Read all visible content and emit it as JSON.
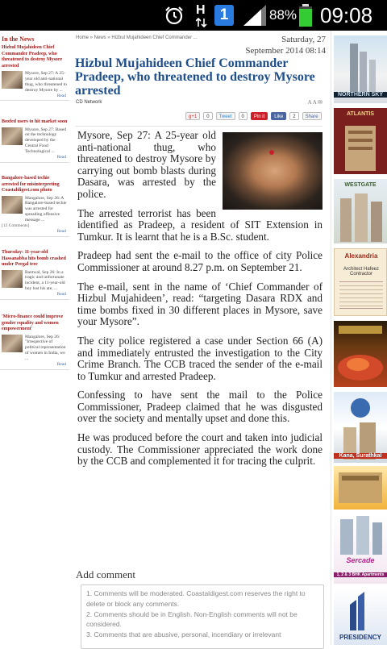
{
  "status_bar": {
    "battery_percent": "88%",
    "time": "09:08",
    "network": "H",
    "notification_badge": "1"
  },
  "sidebar": {
    "title": "In the News",
    "items": [
      {
        "title": "Hizbul Mujahideen Chief Commander Pradeep, who threatened to destroy Mysore arrested",
        "excerpt": "Mysore, Sep 27: A 25-year old anti-national thug, who threatened to destroy Mysore by ...",
        "read": "Read"
      },
      {
        "title": "Boxfed users to hit market soon",
        "excerpt": "Mysore, Sep 27: Based on the technology developed by the Central Food Technological ...",
        "read": "Read"
      },
      {
        "title": "Bangalore-based techie arrested for misinterpreting Coastaldigest.com photo",
        "excerpt": "Mangalore, Sep 26: A Bangalore-based techie was arrested for spreading offensive message ...",
        "comments": "[12 Comments]",
        "read": "Read"
      },
      {
        "title": "Thursday: 11-year-old Hassanabba hits bomb crashed under Pergal tree",
        "excerpt": "Bantwal, Sep 26: In a tragic and unfortunate incident, a 11-year-old boy lost his ate, ...",
        "read": "Read"
      },
      {
        "title": "'Micro-finance could improve gender equality and women empowerment'",
        "excerpt": "Mangalore, Sep 26: \"Irrespective of political representation of women in India, we ...",
        "read": "Read"
      }
    ]
  },
  "article": {
    "breadcrumb": "Home » News » Hizbul Mujahideen Chief Commander ...",
    "date_line1": "Saturday, 27",
    "date_line2": "September 2014 08:14",
    "headline": "Hizbul Mujahideen Chief Commander Pradeep, who threatened to destroy Mysore arrested",
    "author": "CD Network",
    "tools_icons": "A A ✉",
    "share": {
      "gplus": "g+1",
      "gplus_count": "0",
      "tweet": "Tweet",
      "tweet_count": "0",
      "pin": "Pin it",
      "like": "Like",
      "like_count": "2",
      "fb_share": "Share"
    },
    "paragraphs": [
      "Mysore, Sep 27: A 25-year old anti-national thug, who threatened to destroy Mysore by carrying out bomb blasts during Dasara, was arrested by the police.",
      "The arrested terrorist has been identified as Pradeep, a resident of SIT Extension in Tumkur. It is learnt that he is a B.Sc. student.",
      "Pradeep had sent the e-mail to the office of city Police Commissioner at around 8.27 p.m. on September 21.",
      "The e-mail, sent in the name of ‘Chief Commander of Hizbul Mujahideen’, read: “targeting Dasara RDX and time bombs fixed in 30 different places in Mysore, save your Mysore”.",
      "The city police registered a case under Section 66 (A) and immediately entrusted the investigation to the City Crime Branch. The CCB traced the sender of the e-mail to Tumkur and arrested Pradeep.",
      "Confessing to have sent the mail to the Police Commissioner, Pradeep claimed that he was disgusted over the society and mentally upset and done this.",
      "He was produced before the court and taken into judicial custody. The Commissioner appreciated the work done by the CCB and complemented it for tracing the culprit."
    ]
  },
  "comments": {
    "heading": "Add comment",
    "rules": [
      "1. Comments will be moderated. Coastaldigest.com reserves the right to delete or block any comments.",
      "2. Comments should be in English. Non-English comments will not be considered.",
      "3. Comments that are abusive, personal, incendiary or irrelevant"
    ]
  },
  "ads": {
    "labels": [
      "NORTHERN SKY",
      "ATLANTIS",
      "WESTGATE",
      "Alexandria",
      "Architect Hafeez Contractor",
      "Kana, Surathkal",
      "PRESIDENCY",
      "Sercade",
      "1, 2 & 3 BHK Apartments"
    ]
  },
  "colors": {
    "headline": "#1e4f8c",
    "sidebar_link": "#a01818",
    "statusbar_bg": "#000000",
    "battery": "#33cc33",
    "notification_blue": "#2a7be0"
  }
}
